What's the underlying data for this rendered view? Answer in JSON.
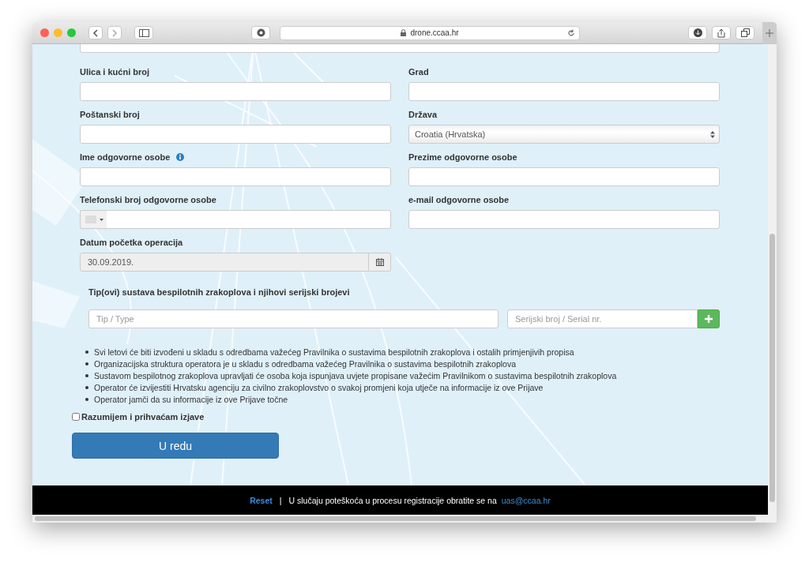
{
  "browser": {
    "url": "drone.ccaa.hr"
  },
  "fields": [
    {
      "label": "Ulica i kućni broj",
      "kind": "text",
      "info": false
    },
    {
      "label": "Grad",
      "kind": "text",
      "info": false
    },
    {
      "label": "Poštanski broj",
      "kind": "text",
      "info": false
    },
    {
      "label": "Država",
      "kind": "select",
      "value": "Croatia (Hrvatska)",
      "info": false
    },
    {
      "label": "Ime odgovorne osobe",
      "kind": "text",
      "info": true
    },
    {
      "label": "Prezime odgovorne osobe",
      "kind": "text",
      "info": false
    },
    {
      "label": "Telefonski broj odgovorne osobe",
      "kind": "phone",
      "info": false
    },
    {
      "label": "e-mail odgovorne osobe",
      "kind": "text",
      "info": false
    },
    {
      "label": "Datum početka operacija",
      "kind": "date",
      "value": "30.09.2019.",
      "info": false
    }
  ],
  "uas": {
    "title": "Tip(ovi) sustava bespilotnih zrakoplova i njihovi serijski brojevi",
    "type_placeholder": "Tip / Type",
    "serial_placeholder": "Serijski broj / Serial nr."
  },
  "statements": [
    "Svi letovi će biti izvođeni u skladu s odredbama važećeg Pravilnika o sustavima bespilotnih zrakoplova i ostalih primjenjivih propisa",
    "Organizacijska struktura operatora je u skladu s odredbama važećeg Pravilnika o sustavima bespilotnih zrakoplova",
    "Sustavom bespilotnog zrakoplova upravljati će osoba koja ispunjava uvjete propisane važećim Pravilnikom o sustavima bespilotnih zrakoplova",
    "Operator će izvijestiti Hrvatsku agenciju za civilno zrakoplovstvo o svakoj promjeni koja utječe na informacije iz ove Prijave",
    "Operator jamči da su informacije iz ove Prijave točne"
  ],
  "accept": {
    "label": "Razumijem i prihvaćam izjave",
    "checked": false
  },
  "submit": "U redu",
  "footer": {
    "reset": "Reset",
    "separator": "|",
    "text": "U slučaju poteškoća u procesu registracije obratite se na",
    "email": "uas@ccaa.hr"
  }
}
